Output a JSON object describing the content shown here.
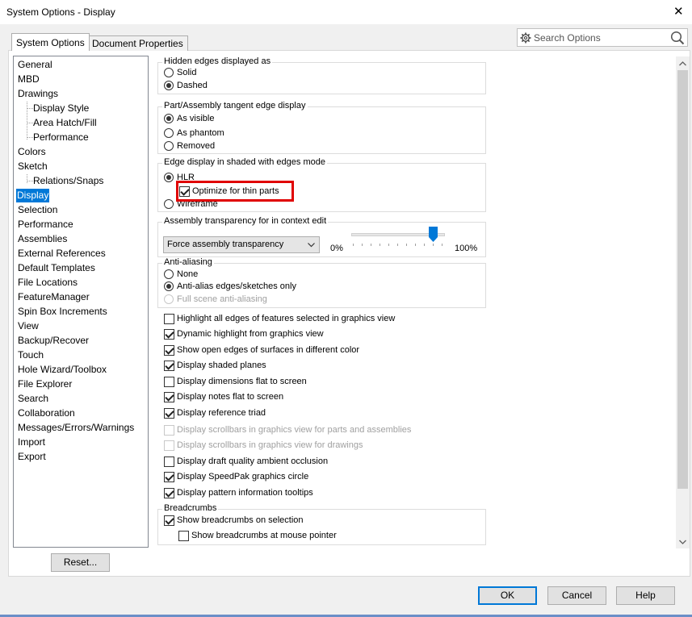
{
  "window": {
    "title": "System Options - Display"
  },
  "tabs": [
    {
      "label": "System Options",
      "active": true
    },
    {
      "label": "Document Properties",
      "active": false
    }
  ],
  "search": {
    "placeholder": "Search Options",
    "value": ""
  },
  "tree": [
    {
      "label": "General"
    },
    {
      "label": "MBD"
    },
    {
      "label": "Drawings"
    },
    {
      "label": "Display Style",
      "child": true
    },
    {
      "label": "Area Hatch/Fill",
      "child": true
    },
    {
      "label": "Performance",
      "child": true
    },
    {
      "label": "Colors"
    },
    {
      "label": "Sketch"
    },
    {
      "label": "Relations/Snaps",
      "child": true
    },
    {
      "label": "Display",
      "selected": true
    },
    {
      "label": "Selection"
    },
    {
      "label": "Performance"
    },
    {
      "label": "Assemblies"
    },
    {
      "label": "External References"
    },
    {
      "label": "Default Templates"
    },
    {
      "label": "File Locations"
    },
    {
      "label": "FeatureManager"
    },
    {
      "label": "Spin Box Increments"
    },
    {
      "label": "View"
    },
    {
      "label": "Backup/Recover"
    },
    {
      "label": "Touch"
    },
    {
      "label": "Hole Wizard/Toolbox"
    },
    {
      "label": "File Explorer"
    },
    {
      "label": "Search"
    },
    {
      "label": "Collaboration"
    },
    {
      "label": "Messages/Errors/Warnings"
    },
    {
      "label": "Import"
    },
    {
      "label": "Export"
    }
  ],
  "groups": {
    "hidden_edges": {
      "title": "Hidden edges displayed as",
      "options": [
        {
          "label": "Solid",
          "selected": false
        },
        {
          "label": "Dashed",
          "selected": true
        }
      ]
    },
    "tangent_edge": {
      "title": "Part/Assembly tangent edge display",
      "options": [
        {
          "label": "As visible",
          "selected": true
        },
        {
          "label": "As phantom",
          "selected": false
        },
        {
          "label": "Removed",
          "selected": false
        }
      ]
    },
    "edge_display": {
      "title": "Edge display in shaded with edges mode",
      "hlr": {
        "label": "HLR",
        "selected": true
      },
      "optimize": {
        "label": "Optimize for thin parts",
        "checked": true
      },
      "wireframe": {
        "label": "Wireframe",
        "selected": false
      }
    },
    "transparency": {
      "title": "Assembly transparency for in context edit",
      "dropdown_value": "Force assembly transparency",
      "slider_min_label": "0%",
      "slider_max_label": "100%",
      "slider_value": 0.9
    },
    "anti_aliasing": {
      "title": "Anti-aliasing",
      "options": [
        {
          "label": "None",
          "selected": false,
          "disabled": false
        },
        {
          "label": "Anti-alias edges/sketches only",
          "selected": true,
          "disabled": false
        },
        {
          "label": "Full scene anti-aliasing",
          "selected": false,
          "disabled": true
        }
      ]
    },
    "breadcrumbs": {
      "title": "Breadcrumbs",
      "show_on_selection": {
        "label": "Show breadcrumbs on selection",
        "checked": true
      },
      "show_at_pointer": {
        "label": "Show breadcrumbs at mouse pointer",
        "checked": false
      }
    }
  },
  "checkboxes": [
    {
      "label": "Highlight all edges of features selected in graphics view",
      "checked": false,
      "disabled": false
    },
    {
      "label": "Dynamic highlight from graphics view",
      "checked": true,
      "disabled": false
    },
    {
      "label": "Show open edges of surfaces in different color",
      "checked": true,
      "disabled": false
    },
    {
      "label": "Display shaded planes",
      "checked": true,
      "disabled": false
    },
    {
      "label": "Display dimensions flat to screen",
      "checked": false,
      "disabled": false
    },
    {
      "label": "Display notes flat to screen",
      "checked": true,
      "disabled": false
    },
    {
      "label": "Display reference triad",
      "checked": true,
      "disabled": false
    },
    {
      "label": "Display scrollbars in graphics view for parts and assemblies",
      "checked": false,
      "disabled": true
    },
    {
      "label": "Display scrollbars in graphics view for drawings",
      "checked": false,
      "disabled": true
    },
    {
      "label": "Display draft quality ambient occlusion",
      "checked": false,
      "disabled": false
    },
    {
      "label": "Display SpeedPak graphics circle",
      "checked": true,
      "disabled": false
    },
    {
      "label": "Display pattern information tooltips",
      "checked": true,
      "disabled": false
    }
  ],
  "buttons": {
    "reset": "Reset...",
    "ok": "OK",
    "cancel": "Cancel",
    "help": "Help"
  },
  "colors": {
    "selection": "#0078d7",
    "callout": "#e00000",
    "slider_thumb": "#0078d7"
  }
}
